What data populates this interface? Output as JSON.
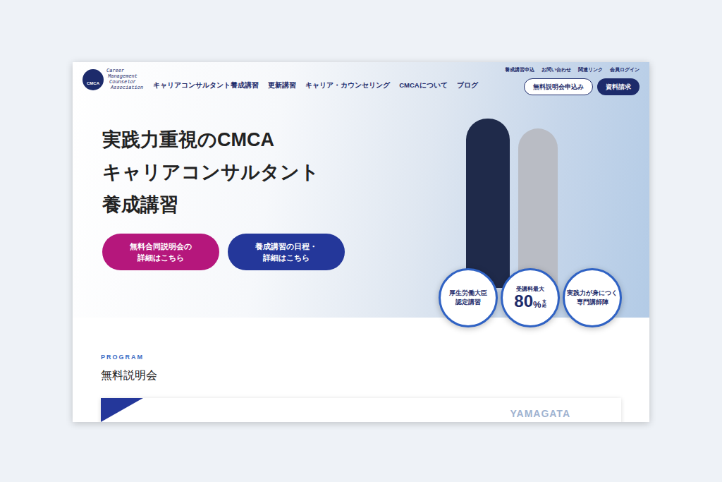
{
  "logo": {
    "mark": "CMCA",
    "name_lines": [
      "Career",
      "Management",
      "Counselor",
      "Association"
    ]
  },
  "nav": [
    "キャリアコンサルタント養成講習",
    "更新講習",
    "キャリア・カウンセリング",
    "CMCAについて",
    "ブログ"
  ],
  "utility_links": [
    "養成講習申込",
    "お問い合わせ",
    "関連リンク",
    "会員ログイン"
  ],
  "header_buttons": [
    {
      "label": "無料説明会申込み",
      "kind": "outline"
    },
    {
      "label": "資料請求",
      "kind": "filled"
    }
  ],
  "hero": {
    "title_lines": [
      "実践力重視のCMCA",
      "キャリアコンサルタント",
      "養成講習"
    ],
    "buttons": [
      {
        "lines": [
          "無料合同説明会の",
          "詳細はこちら"
        ],
        "color": "#b5177c"
      },
      {
        "lines": [
          "養成講習の日程・",
          "詳細はこちら"
        ],
        "color": "#24379a"
      }
    ],
    "badges": [
      {
        "kind": "text",
        "lines": [
          "厚生労働大臣",
          "認定講習"
        ]
      },
      {
        "kind": "percent",
        "label": "受講料最大",
        "number": "80",
        "unit": "%",
        "suffix": "支給"
      },
      {
        "kind": "text",
        "lines": [
          "実践力が身につく",
          "専門講師陣"
        ]
      }
    ]
  },
  "section": {
    "eyebrow": "PROGRAM",
    "title": "無料説明会",
    "card": {
      "region": "YAMAGATA"
    }
  }
}
